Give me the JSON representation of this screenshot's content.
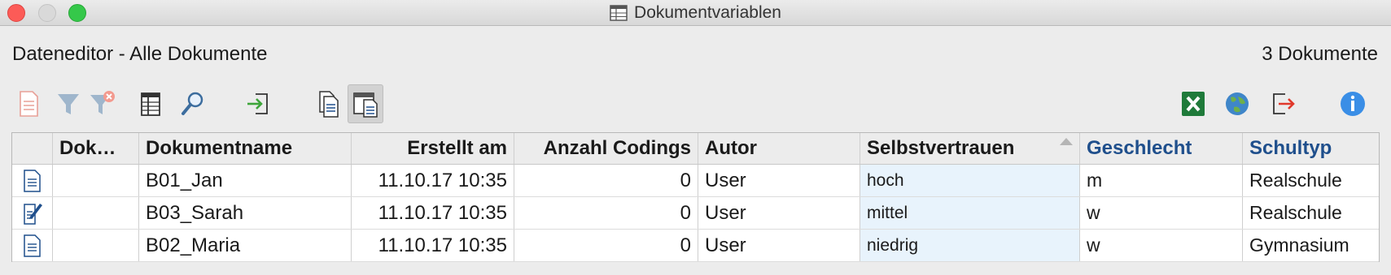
{
  "window": {
    "title": "Dokumentvariablen",
    "controls": [
      "close",
      "minimize",
      "zoom"
    ]
  },
  "header": {
    "title": "Dateneditor - Alle Dokumente",
    "count": "3 Dokumente"
  },
  "toolbar": {
    "left": [
      "new-document-icon",
      "filter-icon",
      "clear-filter-icon",
      "columns-icon",
      "search-icon",
      "import-icon",
      "document-list-icon",
      "document-view-icon"
    ],
    "right": [
      "excel-export-icon",
      "globe-icon",
      "export-icon",
      "info-icon"
    ],
    "active": "document-view-icon",
    "colors": {
      "excel": "#1f7a3a",
      "info": "#3a8ee6",
      "export_arrow": "#e0382b",
      "import_arrow": "#3da53a",
      "filter": "#9fb6cc"
    }
  },
  "table": {
    "columns": [
      {
        "label": "",
        "var": false
      },
      {
        "label": "Dok…",
        "var": false
      },
      {
        "label": "Dokumentname",
        "var": false
      },
      {
        "label": "Erstellt am",
        "var": false
      },
      {
        "label": "Anzahl Codings",
        "var": false
      },
      {
        "label": "Autor",
        "var": false
      },
      {
        "label": "Selbstvertrauen",
        "var": false,
        "sorted": "ascending"
      },
      {
        "label": "Geschlecht",
        "var": true
      },
      {
        "label": "Schultyp",
        "var": true
      }
    ],
    "rows": [
      {
        "icon": "document-icon",
        "dok": "",
        "name": "B01_Jan",
        "created": "11.10.17 10:35",
        "codings": "0",
        "author": "User",
        "selbstvertrauen": "hoch",
        "geschlecht": "m",
        "schultyp": "Realschule"
      },
      {
        "icon": "document-memo-icon",
        "dok": "",
        "name": "B03_Sarah",
        "created": "11.10.17 10:35",
        "codings": "0",
        "author": "User",
        "selbstvertrauen": "mittel",
        "geschlecht": "w",
        "schultyp": "Realschule"
      },
      {
        "icon": "document-icon",
        "dok": "",
        "name": "B02_Maria",
        "created": "11.10.17 10:35",
        "codings": "0",
        "author": "User",
        "selbstvertrauen": "niedrig",
        "geschlecht": "w",
        "schultyp": "Gymnasium"
      }
    ]
  }
}
